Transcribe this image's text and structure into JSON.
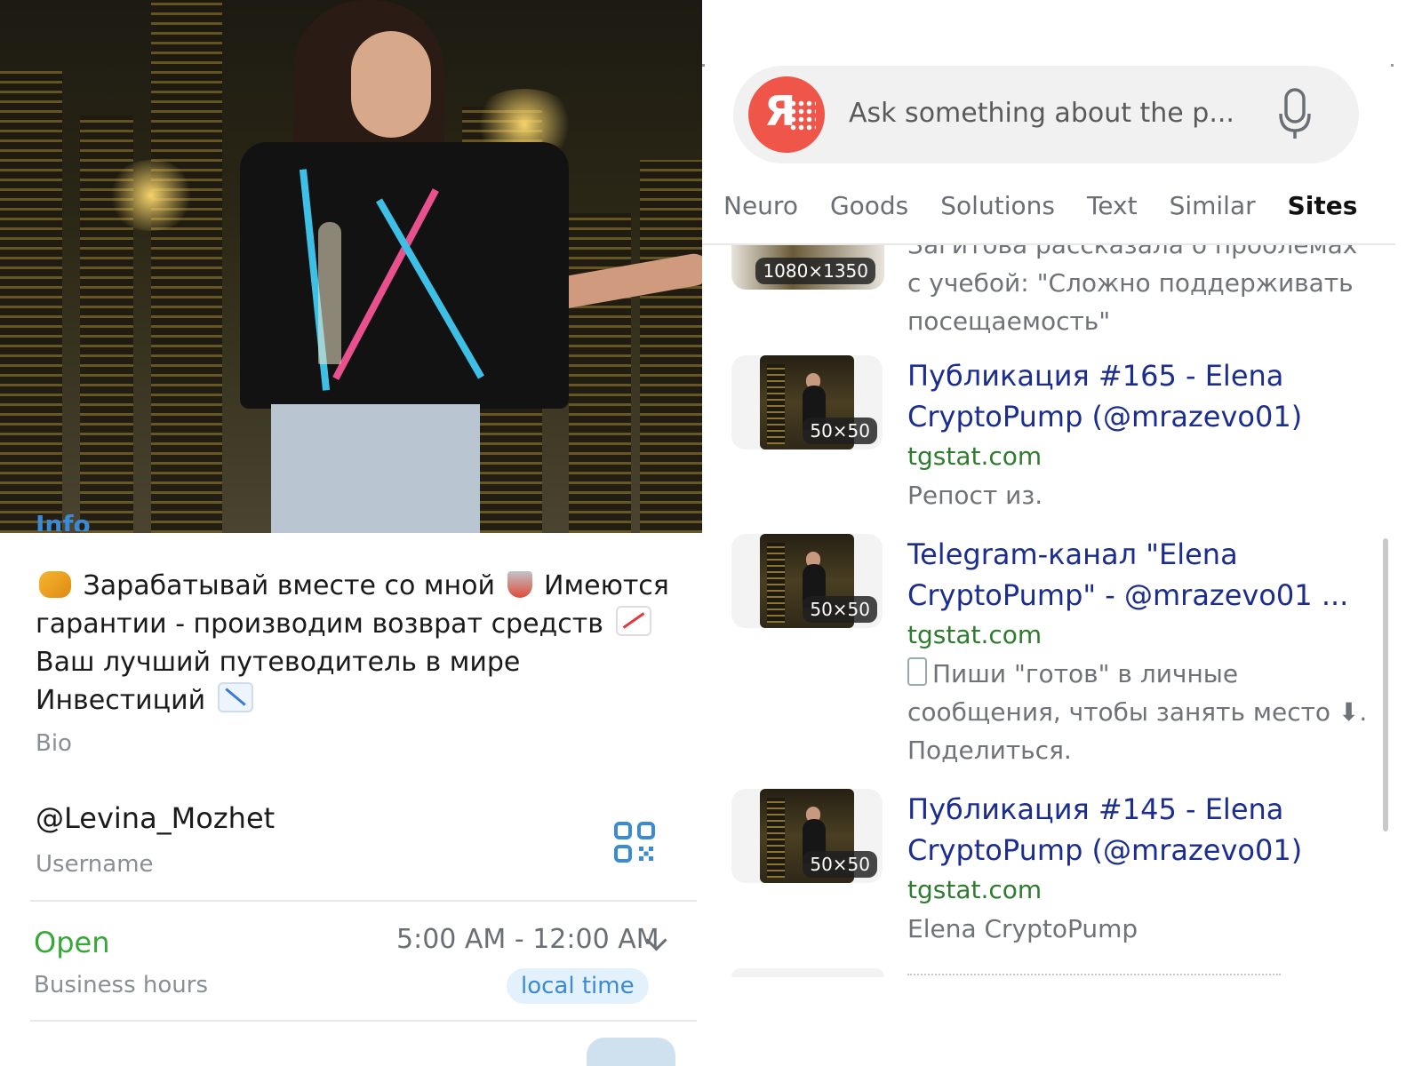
{
  "profile": {
    "info_heading": "Info",
    "bio": {
      "line1": "Зарабатывай вместе со мной",
      "line2": "Имеются гарантии - производим возврат средств",
      "line3": "Ваш лучший путеводитель в мире Инвестиций",
      "label": "Bio",
      "emoji": [
        "handshake",
        "shield",
        "chart-increasing",
        "chart-decreasing"
      ]
    },
    "username": {
      "value": "@Levina_Mozhet",
      "label": "Username"
    },
    "business_hours": {
      "status": "Open",
      "hours": "5:00 AM - 12:00 AM",
      "label": "Business hours",
      "timezone_button": "local time"
    },
    "colors": {
      "open": "#36a838",
      "accent": "#3a8ad6"
    }
  },
  "search": {
    "placeholder": "Ask something about the p...",
    "logo_text": "Я",
    "tabs": [
      "Neuro",
      "Goods",
      "Solutions",
      "Text",
      "Similar",
      "Sites"
    ],
    "active_tab": "Sites",
    "partial_result": {
      "size": "1080×1350",
      "snippet": "Загитова рассказала о проблемах с учебой: \"Сложно поддерживать посещаемость\""
    },
    "results": [
      {
        "size": "50×50",
        "title": "Публикация #165 - Elena CryptoPump (@mrazevo01)",
        "domain": "tgstat.com",
        "snippet": "Репост из."
      },
      {
        "size": "50×50",
        "title": "Telegram-канал \"Elena CryptoPump\" - @mrazevo01 ...",
        "domain": "tgstat.com",
        "snippet": "Пиши \"готов\" в личные сообщения, чтобы занять место ⬇. Поделиться."
      },
      {
        "size": "50×50",
        "title": "Публикация #145 - Elena CryptoPump (@mrazevo01)",
        "domain": "tgstat.com",
        "snippet": "Elena CryptoPump"
      }
    ],
    "colors": {
      "title": "#1b2d8f",
      "domain": "#2e7d2e",
      "logo": "#f0554a"
    }
  }
}
